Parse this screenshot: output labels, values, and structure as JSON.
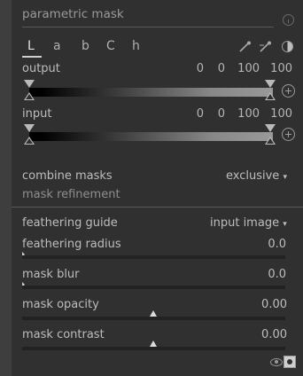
{
  "header": {
    "title": "parametric mask"
  },
  "tabs": [
    {
      "label": "L"
    },
    {
      "label": "a"
    },
    {
      "label": "b"
    },
    {
      "label": "C"
    },
    {
      "label": "h"
    }
  ],
  "output": {
    "label": "output",
    "values": [
      "0",
      "0",
      "100",
      "100"
    ]
  },
  "input": {
    "label": "input",
    "values": [
      "0",
      "0",
      "100",
      "100"
    ]
  },
  "combine": {
    "label": "combine masks",
    "value": "exclusive",
    "caret": "▾"
  },
  "refinement": {
    "label": "mask refinement"
  },
  "feathering_guide": {
    "label": "feathering guide",
    "value": "input image",
    "caret": "▾"
  },
  "rows": [
    {
      "label": "feathering radius",
      "value": "0.0",
      "fraction": 0.0
    },
    {
      "label": "mask blur",
      "value": "0.0",
      "fraction": 0.0
    },
    {
      "label": "mask opacity",
      "value": "0.00",
      "fraction": 0.5
    },
    {
      "label": "mask contrast",
      "value": "0.00",
      "fraction": 0.5
    }
  ],
  "icons": {
    "info": "info-icon",
    "picker": "color-picker-icon",
    "picker_area": "color-picker-area-icon",
    "invert": "invert-polarity-icon",
    "add": "add-icon",
    "show_mask": "eye-icon",
    "mask_display": "mask-display-icon"
  }
}
